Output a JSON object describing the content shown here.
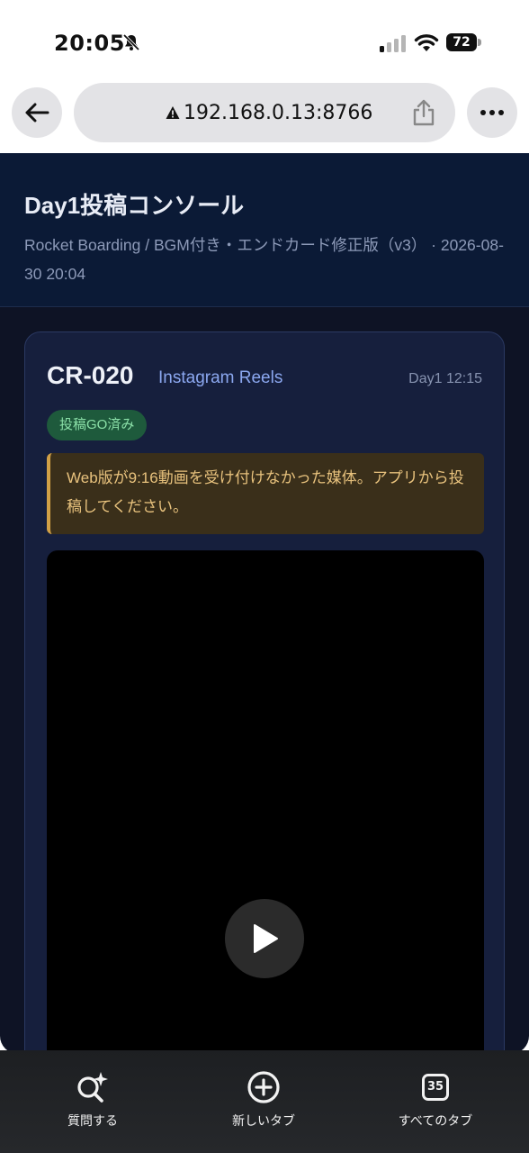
{
  "status_bar": {
    "time": "20:05",
    "battery": "72"
  },
  "browser": {
    "url": "192.168.0.13:8766"
  },
  "header": {
    "title": "Day1投稿コンソール",
    "subtitle": "Rocket Boarding / BGM付き・エンドカード修正版（v3） · 2026-08-30 20:04"
  },
  "card": {
    "id": "CR-020",
    "platform": "Instagram Reels",
    "time": "Day1 12:15",
    "badge": "投稿GO済み",
    "notice": "Web版が9:16動画を受け付けなかった媒体。アプリから投稿してください。"
  },
  "bottom_bar": {
    "ask_label": "質問する",
    "new_tab_label": "新しいタブ",
    "all_tabs_label": "すべてのタブ",
    "tab_count": "35"
  },
  "colors": {
    "page_bg": "#0e1325",
    "header_bg": "#0b1a36",
    "card_bg": "#161f3d",
    "badge_bg": "#1e5a3c",
    "notice_border": "#d1a046",
    "platform_text": "#8ba7ef"
  },
  "icons": [
    "bell-slash-icon",
    "signal-icon",
    "wifi-icon",
    "battery-icon",
    "back-arrow-icon",
    "warning-icon",
    "share-icon",
    "more-icon",
    "play-icon",
    "ask-sparkle-search-icon",
    "plus-circle-icon",
    "tabs-icon"
  ]
}
